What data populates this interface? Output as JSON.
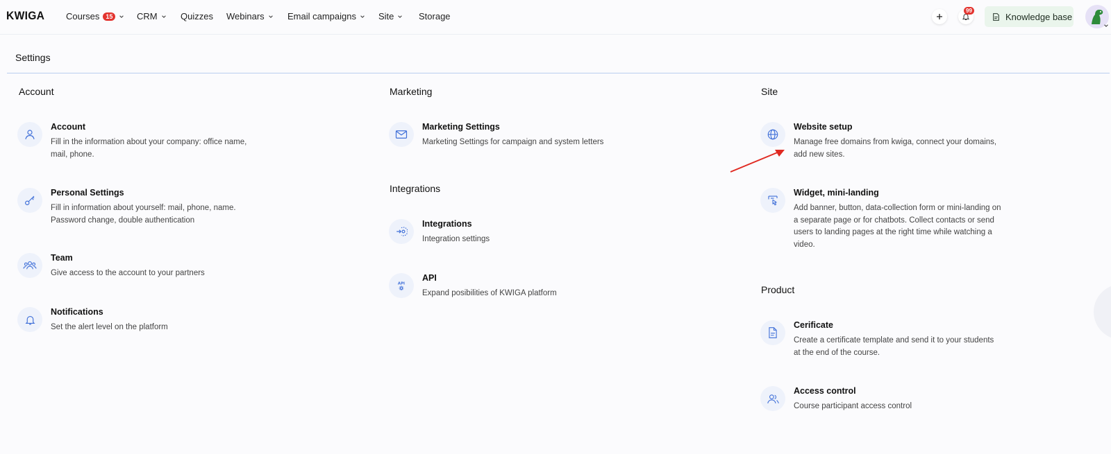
{
  "app": {
    "logo": "KWIGA",
    "nav": [
      {
        "label": "Courses",
        "badge": "15",
        "dropdown": true
      },
      {
        "label": "CRM",
        "dropdown": true
      },
      {
        "label": "Quizzes",
        "dropdown": false
      },
      {
        "label": "Webinars",
        "dropdown": true
      },
      {
        "label": "Email campaigns",
        "dropdown": true
      },
      {
        "label": "Site",
        "dropdown": true
      },
      {
        "label": "Storage",
        "dropdown": false
      }
    ],
    "actions": {
      "add_icon": "plus-icon",
      "notifications_badge": "99",
      "knowledge_base_label": "Knowledge base"
    },
    "accent_color": "#3f6fd8",
    "badge_color": "#e3342f"
  },
  "page": {
    "title": "Settings"
  },
  "columns": [
    {
      "sections": [
        {
          "heading": "Account",
          "items": [
            {
              "icon": "user-icon",
              "title": "Account",
              "desc": "Fill in the information about your company: office name, mail, phone."
            },
            {
              "icon": "key-icon",
              "title": "Personal Settings",
              "desc": "Fill in information about yourself: mail, phone, name. Password change, double authentication"
            },
            {
              "icon": "team-icon",
              "title": "Team",
              "desc": "Give access to the account to your partners"
            },
            {
              "icon": "bell-icon",
              "title": "Notifications",
              "desc": "Set the alert level on the platform"
            }
          ]
        }
      ]
    },
    {
      "sections": [
        {
          "heading": "Marketing",
          "items": [
            {
              "icon": "mail-icon",
              "title": "Marketing Settings",
              "desc": "Marketing Settings for campaign and system letters"
            }
          ]
        },
        {
          "heading": "Integrations",
          "items": [
            {
              "icon": "integration-icon",
              "title": "Integrations",
              "desc": "Integration settings"
            },
            {
              "icon": "api-icon",
              "title": "API",
              "desc": "Expand posibilities of KWIGA platform"
            }
          ]
        }
      ]
    },
    {
      "sections": [
        {
          "heading": "Site",
          "items": [
            {
              "icon": "globe-icon",
              "title": "Website setup",
              "desc": "Manage free domains from kwiga, connect your domains, add new sites."
            },
            {
              "icon": "widget-icon",
              "title": "Widget, mini-landing",
              "desc": "Add banner, button, data-collection form or mini-landing on a separate page or for chatbots. Collect contacts or send users to landing pages at the right time while watching a video."
            }
          ]
        },
        {
          "heading": "Product",
          "items": [
            {
              "icon": "document-icon",
              "title": "Cerificate",
              "desc": "Create a certificate template and send it to your students at the end of the course."
            },
            {
              "icon": "access-users-icon",
              "title": "Access control",
              "desc": "Course participant access control"
            }
          ]
        }
      ]
    }
  ]
}
